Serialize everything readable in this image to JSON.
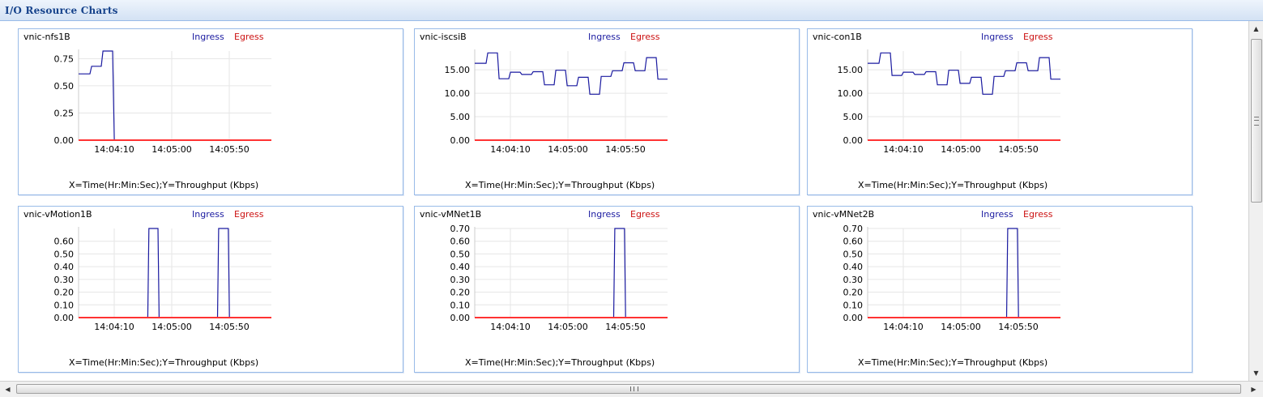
{
  "window": {
    "title": "I/O Resource Charts"
  },
  "colors": {
    "ingress": "#1a1aa0",
    "egress": "#ff3333",
    "grid": "#e6e6e6",
    "border": "#99bbe8"
  },
  "chart_data": [
    {
      "type": "line",
      "title": "vnic-nfs1B",
      "caption": "X=Time(Hr:Min:Sec);Y=Throughput (Kbps)",
      "x_tick_labels": [
        "14:04:10",
        "14:05:00",
        "14:05:50"
      ],
      "y_ticks": [
        "0.00",
        "0.25",
        "0.50",
        "0.75"
      ],
      "ylim": [
        0,
        0.82
      ],
      "xlim": [
        0,
        34
      ],
      "series": [
        {
          "name": "Ingress",
          "x": [
            0,
            2,
            2.3,
            4,
            4.3,
            6,
            6.3,
            32,
            32.3,
            34
          ],
          "y": [
            0.61,
            0.61,
            0.68,
            0.68,
            0.82,
            0.82,
            0.0,
            0.0,
            0.0,
            0.0
          ]
        },
        {
          "name": "Egress",
          "x": [
            0,
            34
          ],
          "y": [
            0,
            0
          ]
        }
      ]
    },
    {
      "type": "line",
      "title": "vnic-iscsiB",
      "caption": "X=Time(Hr:Min:Sec);Y=Throughput (Kbps)",
      "x_tick_labels": [
        "14:04:10",
        "14:05:00",
        "14:05:50"
      ],
      "y_ticks": [
        "0.00",
        "5.00",
        "10.00",
        "15.00"
      ],
      "ylim": [
        0,
        19
      ],
      "xlim": [
        0,
        34
      ],
      "series": [
        {
          "name": "Ingress",
          "x": [
            0,
            2,
            2.3,
            4,
            4.3,
            6,
            6.3,
            8,
            8.3,
            10,
            10.3,
            12,
            12.3,
            14,
            14.3,
            16,
            16.3,
            18,
            18.3,
            20,
            20.3,
            22,
            22.3,
            24,
            24.3,
            26,
            26.3,
            28,
            28.3,
            30,
            30.3,
            32,
            32.3,
            34
          ],
          "y": [
            16.4,
            16.4,
            18.6,
            18.6,
            13.1,
            13.1,
            14.5,
            14.5,
            14.0,
            14.0,
            14.6,
            14.6,
            11.8,
            11.8,
            14.9,
            14.9,
            11.6,
            11.6,
            13.4,
            13.4,
            9.8,
            9.8,
            13.6,
            13.6,
            14.8,
            14.8,
            16.5,
            16.5,
            14.8,
            14.8,
            17.6,
            17.6,
            13.0,
            13.0
          ]
        },
        {
          "name": "Egress",
          "x": [
            0,
            34
          ],
          "y": [
            0,
            0
          ]
        }
      ]
    },
    {
      "type": "line",
      "title": "vnic-con1B",
      "caption": "X=Time(Hr:Min:Sec);Y=Throughput (Kbps)",
      "x_tick_labels": [
        "14:04:10",
        "14:05:00",
        "14:05:50"
      ],
      "y_ticks": [
        "0.00",
        "5.00",
        "10.00",
        "15.00"
      ],
      "ylim": [
        0,
        19
      ],
      "xlim": [
        0,
        34
      ],
      "series": [
        {
          "name": "Ingress",
          "x": [
            0,
            2,
            2.3,
            4,
            4.3,
            6,
            6.3,
            8,
            8.3,
            10,
            10.3,
            12,
            12.3,
            14,
            14.3,
            16,
            16.3,
            18,
            18.3,
            20,
            20.3,
            22,
            22.3,
            24,
            24.3,
            26,
            26.3,
            28,
            28.3,
            30,
            30.3,
            32,
            32.3,
            34
          ],
          "y": [
            16.4,
            16.4,
            18.6,
            18.6,
            13.8,
            13.8,
            14.5,
            14.5,
            14.0,
            14.0,
            14.6,
            14.6,
            11.8,
            11.8,
            14.9,
            14.9,
            12.1,
            12.1,
            13.4,
            13.4,
            9.8,
            9.8,
            13.6,
            13.6,
            14.8,
            14.8,
            16.5,
            16.5,
            14.8,
            14.8,
            17.6,
            17.6,
            13.0,
            13.0
          ]
        },
        {
          "name": "Egress",
          "x": [
            0,
            34
          ],
          "y": [
            0,
            0
          ]
        }
      ]
    },
    {
      "type": "line",
      "title": "vnic-vMotion1B",
      "caption": "X=Time(Hr:Min:Sec);Y=Throughput (Kbps)",
      "x_tick_labels": [
        "14:04:10",
        "14:05:00",
        "14:05:50"
      ],
      "y_ticks": [
        "0.00",
        "0.10",
        "0.20",
        "0.30",
        "0.40",
        "0.50",
        "0.60"
      ],
      "ylim": [
        0,
        0.7
      ],
      "xlim": [
        0,
        34
      ],
      "series": [
        {
          "name": "Ingress",
          "x": [
            0,
            12.2,
            12.4,
            14,
            14.2,
            24.5,
            24.7,
            26.4,
            26.6,
            34
          ],
          "y": [
            0,
            0,
            0.7,
            0.7,
            0,
            0,
            0.7,
            0.7,
            0,
            0
          ]
        },
        {
          "name": "Egress",
          "x": [
            0,
            34
          ],
          "y": [
            0,
            0
          ]
        }
      ]
    },
    {
      "type": "line",
      "title": "vnic-vMNet1B",
      "caption": "X=Time(Hr:Min:Sec);Y=Throughput (Kbps)",
      "x_tick_labels": [
        "14:04:10",
        "14:05:00",
        "14:05:50"
      ],
      "y_ticks": [
        "0.00",
        "0.10",
        "0.20",
        "0.30",
        "0.40",
        "0.50",
        "0.60",
        "0.70"
      ],
      "ylim": [
        0,
        0.7
      ],
      "xlim": [
        0,
        34
      ],
      "series": [
        {
          "name": "Ingress",
          "x": [
            0,
            24.5,
            24.7,
            26.4,
            26.6,
            34
          ],
          "y": [
            0,
            0,
            0.7,
            0.7,
            0,
            0
          ]
        },
        {
          "name": "Egress",
          "x": [
            0,
            34
          ],
          "y": [
            0,
            0
          ]
        }
      ]
    },
    {
      "type": "line",
      "title": "vnic-vMNet2B",
      "caption": "X=Time(Hr:Min:Sec);Y=Throughput (Kbps)",
      "x_tick_labels": [
        "14:04:10",
        "14:05:00",
        "14:05:50"
      ],
      "y_ticks": [
        "0.00",
        "0.10",
        "0.20",
        "0.30",
        "0.40",
        "0.50",
        "0.60",
        "0.70"
      ],
      "ylim": [
        0,
        0.7
      ],
      "xlim": [
        0,
        34
      ],
      "series": [
        {
          "name": "Ingress",
          "x": [
            0,
            24.5,
            24.7,
            26.4,
            26.6,
            34
          ],
          "y": [
            0,
            0,
            0.7,
            0.7,
            0,
            0
          ]
        },
        {
          "name": "Egress",
          "x": [
            0,
            34
          ],
          "y": [
            0,
            0
          ]
        }
      ]
    }
  ]
}
